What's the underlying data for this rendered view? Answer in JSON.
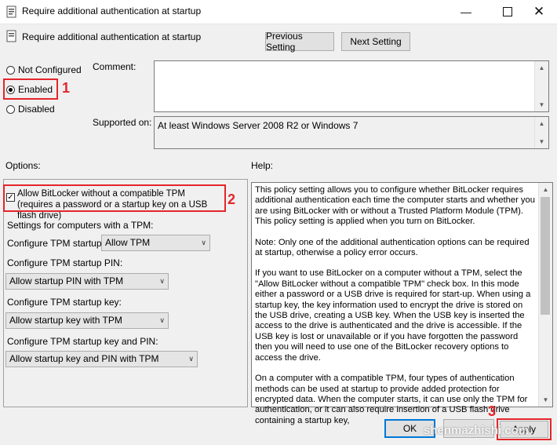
{
  "window": {
    "title": "Require additional authentication at startup",
    "setting_name": "Require additional authentication at startup"
  },
  "nav": {
    "previous": "Previous Setting",
    "next": "Next Setting"
  },
  "state": {
    "not_configured": "Not Configured",
    "enabled": "Enabled",
    "disabled": "Disabled",
    "selected": "Enabled"
  },
  "comment": {
    "label": "Comment:",
    "value": ""
  },
  "supported": {
    "label": "Supported on:",
    "value": "At least Windows Server 2008 R2 or Windows 7"
  },
  "options": {
    "label": "Options:",
    "allow_bitlocker": "Allow BitLocker without a compatible TPM (requires a password or a startup key on a USB flash drive)",
    "allow_bitlocker_checked": true,
    "tpm_settings_label": "Settings for computers with a TPM:",
    "tpm_startup_label": "Configure TPM startup:",
    "tpm_startup_value": "Allow TPM",
    "pin_label": "Configure TPM startup PIN:",
    "pin_value": "Allow startup PIN with TPM",
    "key_label": "Configure TPM startup key:",
    "key_value": "Allow startup key with TPM",
    "keypin_label": "Configure TPM startup key and PIN:",
    "keypin_value": "Allow startup key and PIN with TPM"
  },
  "help": {
    "label": "Help:",
    "paragraphs": [
      "This policy setting allows you to configure whether BitLocker requires additional authentication each time the computer starts and whether you are using BitLocker with or without a Trusted Platform Module (TPM). This policy setting is applied when you turn on BitLocker.",
      "Note: Only one of the additional authentication options can be required at startup, otherwise a policy error occurs.",
      "If you want to use BitLocker on a computer without a TPM, select the \"Allow BitLocker without a compatible TPM\" check box. In this mode either a password or a USB drive is required for start-up. When using a startup key, the key information used to encrypt the drive is stored on the USB drive, creating a USB key. When the USB key is inserted the access to the drive is authenticated and the drive is accessible. If the USB key is lost or unavailable or if you have forgotten the password then you will need to use one of the BitLocker recovery options to access the drive.",
      "On a computer with a compatible TPM, four types of authentication methods can be used at startup to provide added protection for encrypted data. When the computer starts, it can use only the TPM for authentication, or it can also require insertion of a USB flash drive containing a startup key,"
    ]
  },
  "buttons": {
    "ok": "OK",
    "apply": "Apply"
  },
  "annotations": {
    "one": "1",
    "two": "2",
    "three": "3"
  },
  "watermark": "shenmazhishi.com",
  "colors": {
    "annotation_red": "#e3262b",
    "accent": "#0078d7"
  }
}
